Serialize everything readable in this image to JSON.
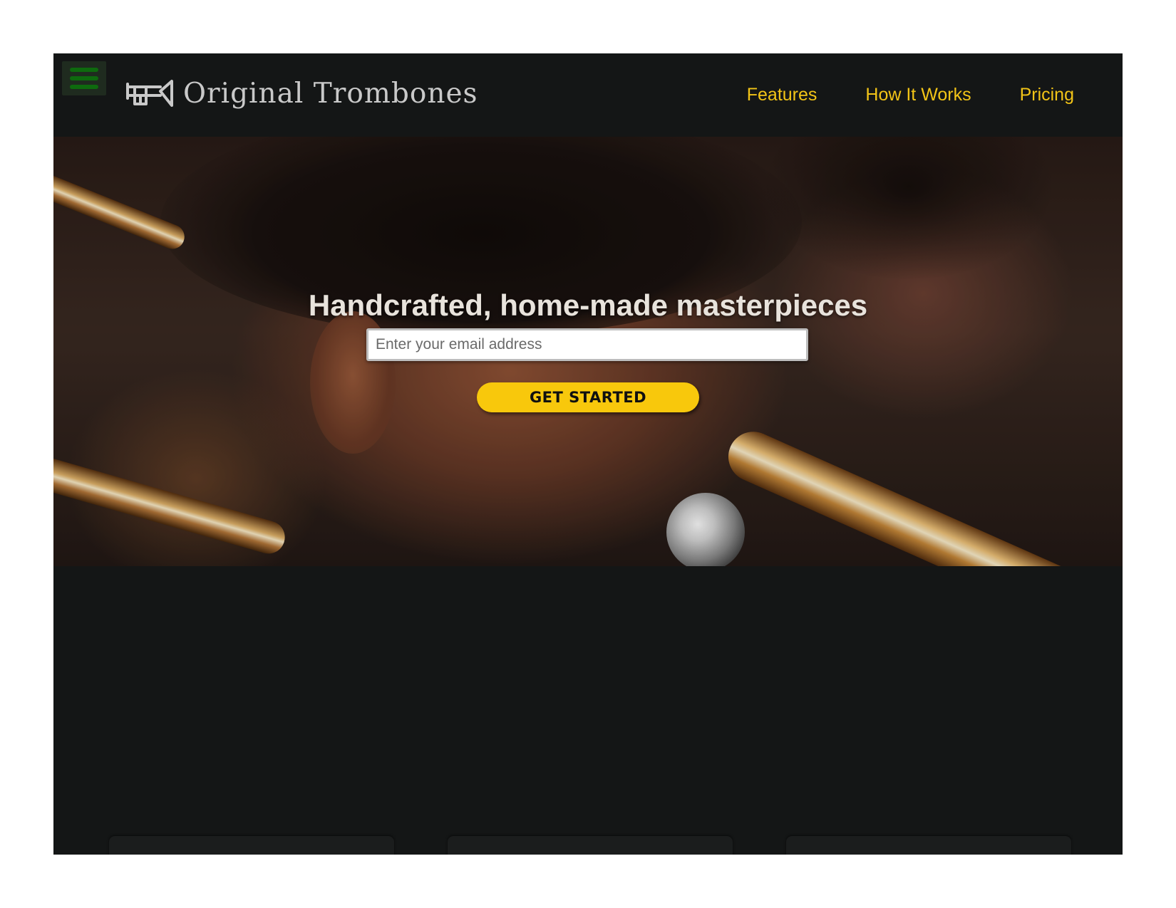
{
  "brand": {
    "name": "Original Trombones",
    "logo_icon": "trombone-icon"
  },
  "nav": {
    "menu_icon": "hamburger-menu-icon",
    "items": [
      {
        "label": "Features"
      },
      {
        "label": "How It Works"
      },
      {
        "label": "Pricing"
      }
    ]
  },
  "hero": {
    "title": "Handcrafted, home-made masterpieces",
    "email_placeholder": "Enter your email address",
    "email_value": "",
    "cta_label": "GET STARTED"
  },
  "colors": {
    "background": "#141616",
    "nav_link": "#f2c417",
    "cta": "#f8c80c",
    "menu_icon": "#0e6a0e",
    "brand_text": "#c9c9c9"
  }
}
